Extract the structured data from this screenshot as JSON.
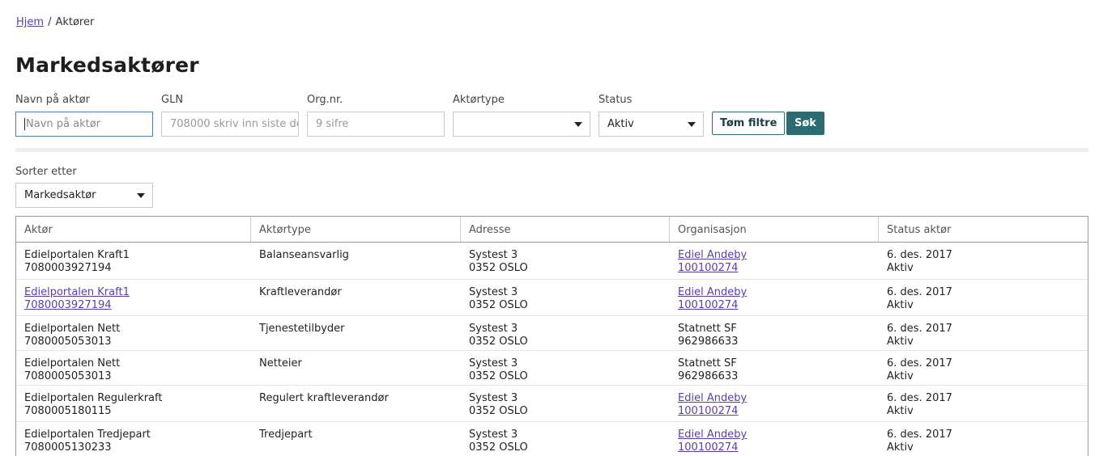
{
  "breadcrumb": {
    "home": "Hjem",
    "separator": "/",
    "current": "Aktører"
  },
  "page": {
    "title": "Markedsaktører"
  },
  "filters": {
    "name": {
      "label": "Navn på aktør",
      "placeholder": "Navn på aktør"
    },
    "gln": {
      "label": "GLN",
      "placeholder": "708000 skriv inn siste de"
    },
    "orgnr": {
      "label": "Org.nr.",
      "placeholder": "9 sifre"
    },
    "actortype": {
      "label": "Aktørtype",
      "value": ""
    },
    "status": {
      "label": "Status",
      "value": "Aktiv"
    },
    "clear_label": "Tøm filtre",
    "search_label": "Søk"
  },
  "sort": {
    "label": "Sorter etter",
    "value": "Markedsaktør"
  },
  "table": {
    "headers": [
      "Aktør",
      "Aktørtype",
      "Adresse",
      "Organisasjon",
      "Status aktør"
    ],
    "rows": [
      {
        "actor_name": "Edielportalen Kraft1",
        "actor_gln": "7080003927194",
        "actor_link": false,
        "type": "Balanseansvarlig",
        "address1": "Systest 3",
        "address2": "0352 OSLO",
        "org_name": "Ediel Andeby",
        "org_nr": "100100274",
        "org_link": true,
        "date": "6. des. 2017",
        "status": "Aktiv"
      },
      {
        "actor_name": "Edielportalen Kraft1",
        "actor_gln": "7080003927194",
        "actor_link": true,
        "type": "Kraftleverandør",
        "address1": "Systest 3",
        "address2": "0352 OSLO",
        "org_name": "Ediel Andeby",
        "org_nr": "100100274",
        "org_link": true,
        "date": "6. des. 2017",
        "status": "Aktiv"
      },
      {
        "actor_name": "Edielportalen Nett",
        "actor_gln": "7080005053013",
        "actor_link": false,
        "type": "Tjenestetilbyder",
        "address1": "Systest 3",
        "address2": "0352 OSLO",
        "org_name": "Statnett SF",
        "org_nr": "962986633",
        "org_link": false,
        "date": "6. des. 2017",
        "status": "Aktiv"
      },
      {
        "actor_name": "Edielportalen Nett",
        "actor_gln": "7080005053013",
        "actor_link": false,
        "type": "Netteier",
        "address1": "Systest 3",
        "address2": "0352 OSLO",
        "org_name": "Statnett SF",
        "org_nr": "962986633",
        "org_link": false,
        "date": "6. des. 2017",
        "status": "Aktiv"
      },
      {
        "actor_name": "Edielportalen Regulerkraft",
        "actor_gln": "7080005180115",
        "actor_link": false,
        "type": "Regulert kraftleverandør",
        "address1": "Systest 3",
        "address2": "0352 OSLO",
        "org_name": "Ediel Andeby",
        "org_nr": "100100274",
        "org_link": true,
        "date": "6. des. 2017",
        "status": "Aktiv"
      },
      {
        "actor_name": "Edielportalen Tredjepart",
        "actor_gln": "7080005130233",
        "actor_link": false,
        "type": "Tredjepart",
        "address1": "Systest 3",
        "address2": "0352 OSLO",
        "org_name": "Ediel Andeby",
        "org_nr": "100100274",
        "org_link": true,
        "date": "6. des. 2017",
        "status": "Aktiv"
      }
    ]
  }
}
